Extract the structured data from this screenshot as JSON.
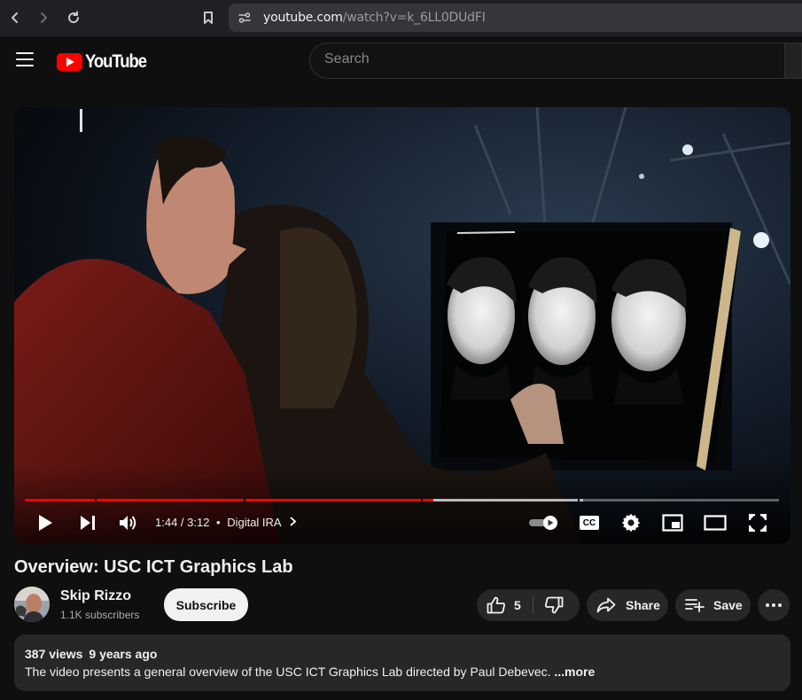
{
  "browser": {
    "url_host": "youtube.com",
    "url_path": "/watch?v=k_6LL0DUdFI"
  },
  "header": {
    "logo_text": "YouTube",
    "search_placeholder": "Search"
  },
  "player": {
    "current_time": "1:44",
    "duration": "3:12",
    "time_display": "1:44 / 3:12",
    "chapter_separator": "•",
    "chapter": "Digital IRA",
    "played_fraction": 0.542,
    "buffered_fraction": 0.74,
    "autoplay_on": true,
    "cc_label": "CC"
  },
  "video": {
    "title": "Overview: USC ICT Graphics Lab"
  },
  "channel": {
    "name": "Skip Rizzo",
    "subscribers": "1.1K subscribers",
    "subscribe_label": "Subscribe"
  },
  "actions": {
    "like_count": "5",
    "share_label": "Share",
    "save_label": "Save"
  },
  "description": {
    "views": "387 views",
    "age": "9 years ago",
    "text": "The video presents a general overview of the USC ICT Graphics Lab directed by Paul Debevec.",
    "more_label": "...more"
  },
  "colors": {
    "accent": "#ff0000",
    "background": "#0f0f0f",
    "pill": "#272727"
  }
}
